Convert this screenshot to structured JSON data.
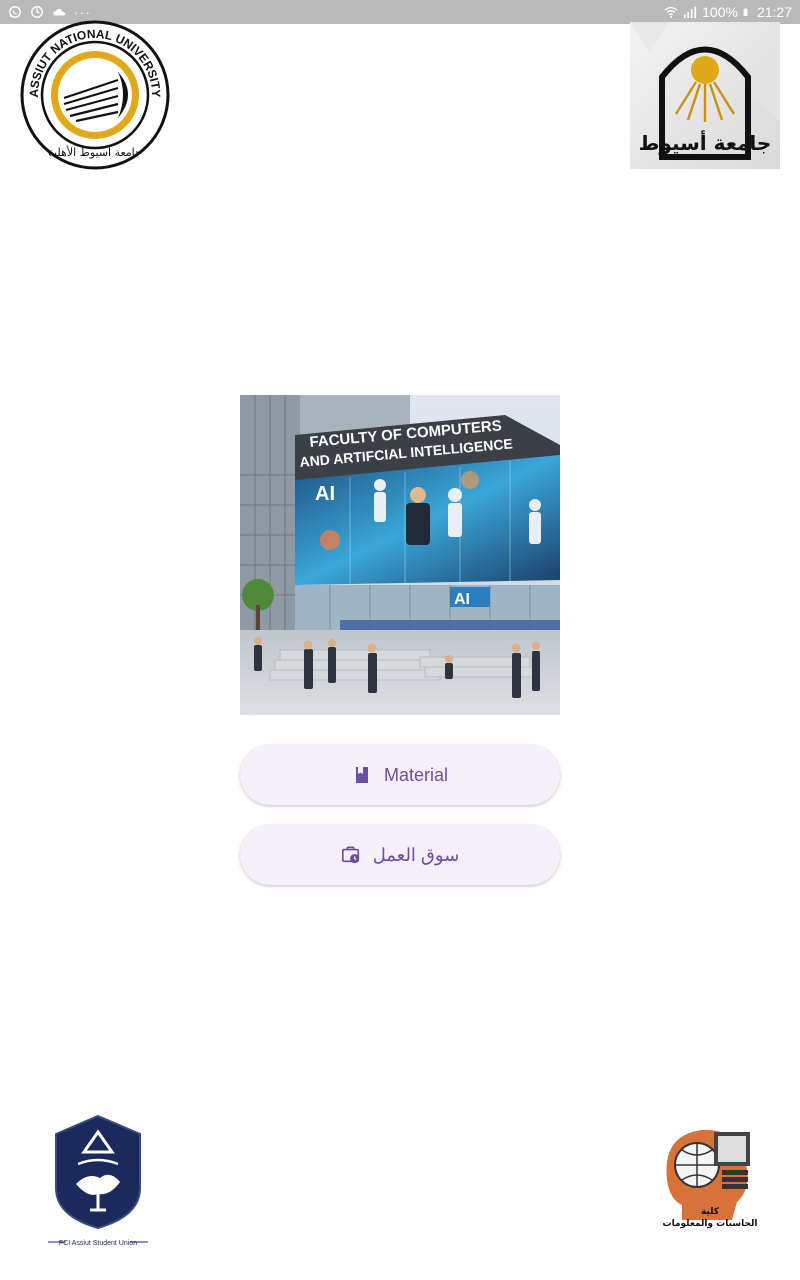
{
  "status_bar": {
    "battery_text": "100%",
    "time": "21:27",
    "more_dots": "···"
  },
  "logos": {
    "top_left": "ASSIUT NATIONAL UNIVERSITY",
    "top_left_arabic": "جامعة أسيوط الأهلية",
    "top_right_arabic": "جامعة أسيوط",
    "bottom_left": "FCI Assiut Student Union",
    "bottom_right_arabic_1": "كلية",
    "bottom_right_arabic_2": "الحاسبات والمعلومات"
  },
  "hero": {
    "sign_line1": "FACULTY OF COMPUTERS",
    "sign_line2": "AND ARTIFCIAL INTELLIGENCE",
    "screen_text": "AI"
  },
  "buttons": {
    "material_label": "Material",
    "material_icon": "book-icon",
    "market_label": "سوق العمل",
    "market_icon": "work-history-icon"
  },
  "colors": {
    "status_bar": "#b9b9b9",
    "button_bg": "#f4eff8",
    "button_fg": "#6a4fa0",
    "gold": "#e0a91a"
  }
}
